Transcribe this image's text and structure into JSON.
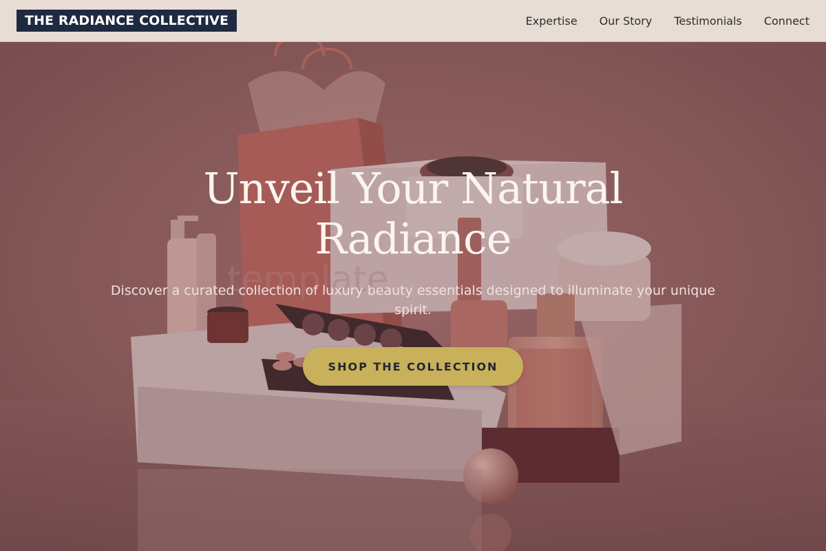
{
  "header": {
    "brand": "THE RADIANCE COLLECTIVE",
    "nav": [
      {
        "label": "Expertise"
      },
      {
        "label": "Our Story"
      },
      {
        "label": "Testimonials"
      },
      {
        "label": "Connect"
      }
    ]
  },
  "hero": {
    "title": "Unveil Your Natural Radiance",
    "subtitle": "Discover a curated collection of luxury beauty essentials designed to illuminate your unique spirit.",
    "cta_label": "SHOP THE COLLECTION",
    "watermark": "template"
  },
  "colors": {
    "header_bg": "#e7ddd5",
    "brand_bg": "#1f2a40",
    "hero_overlay": "#7a5456",
    "cta_bg": "#c8b15a",
    "cta_text": "#232634"
  }
}
